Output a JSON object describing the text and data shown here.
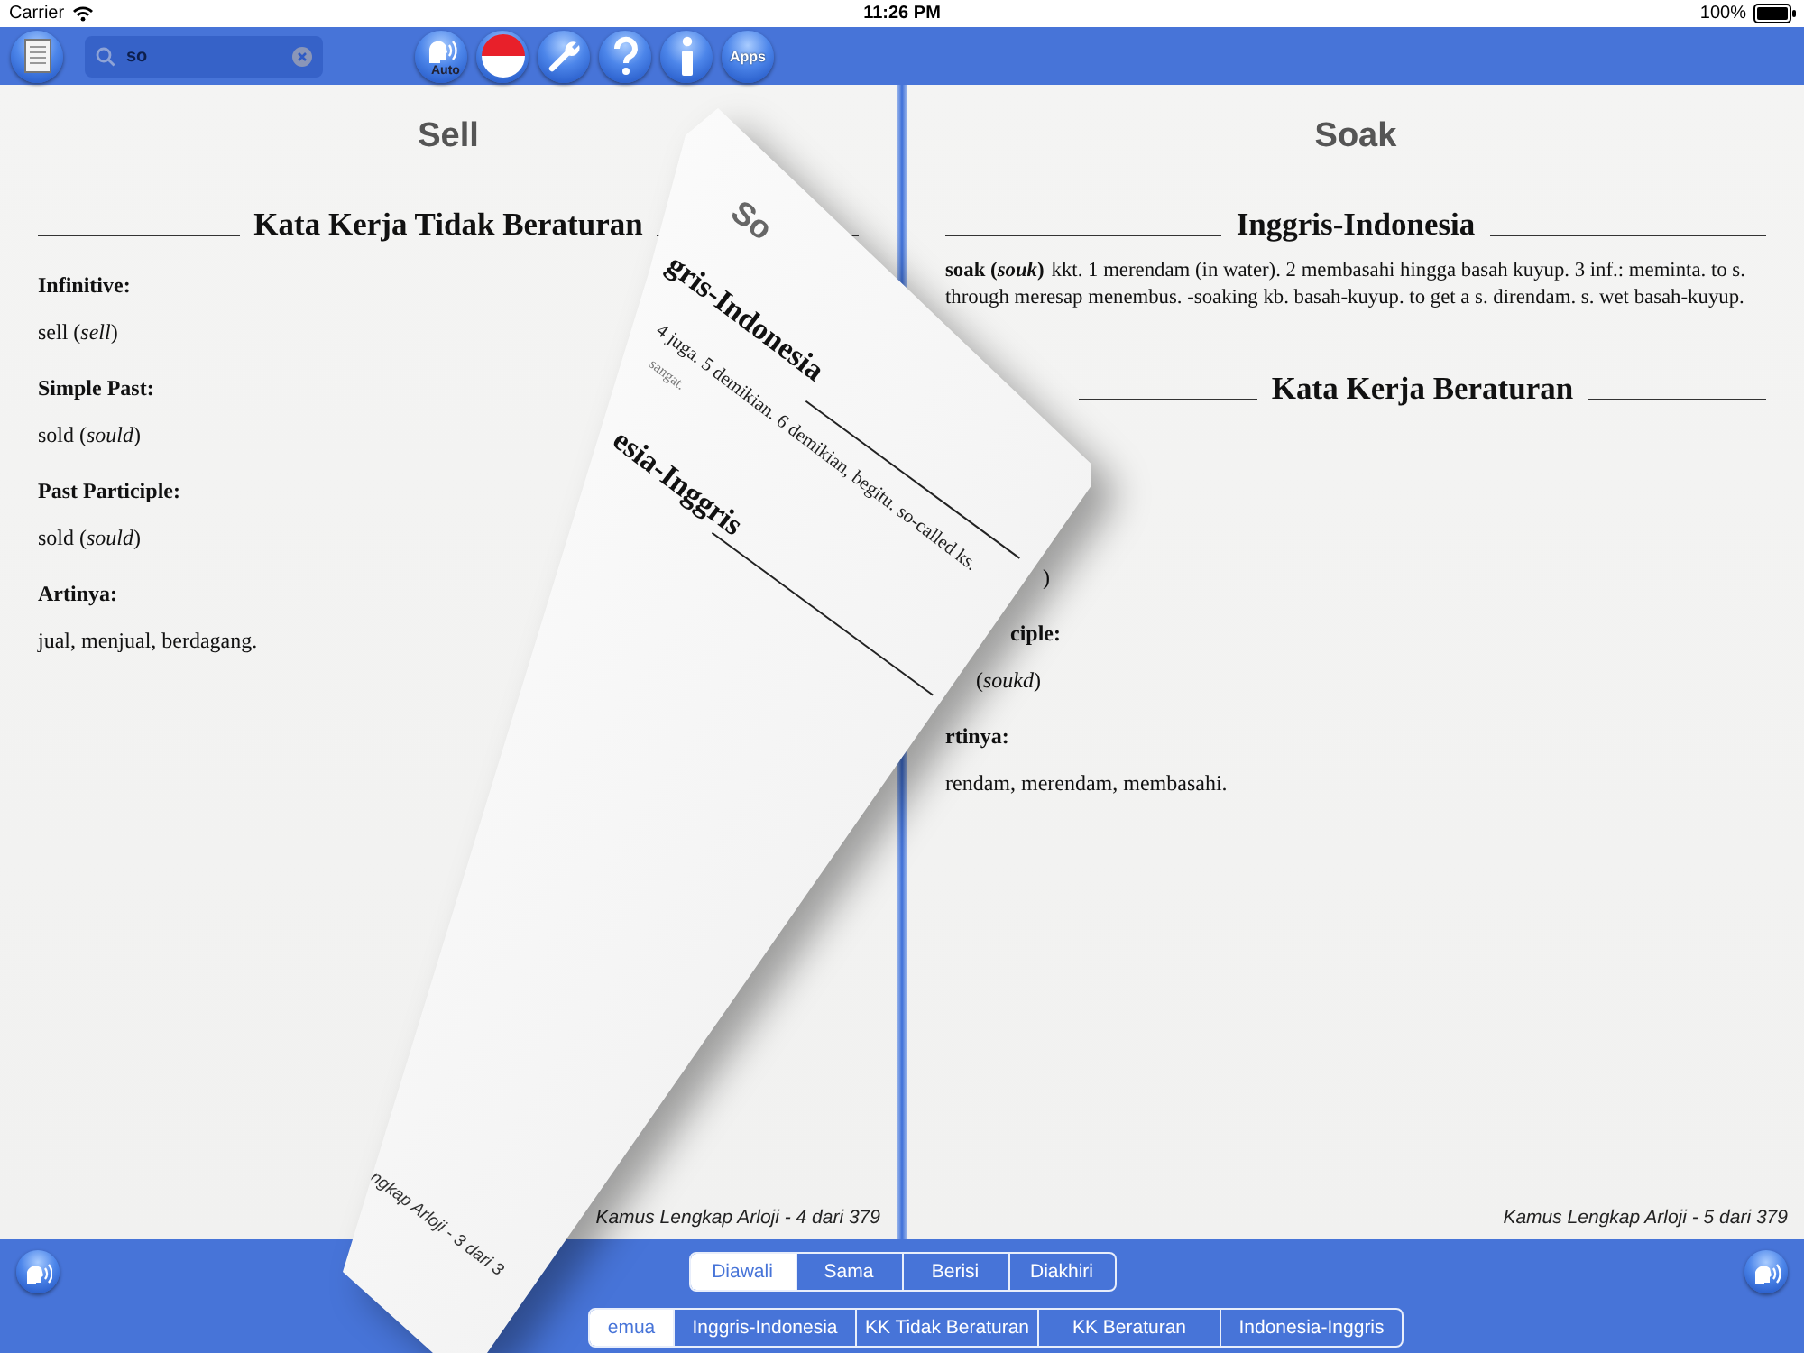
{
  "status_bar": {
    "carrier": "Carrier",
    "time": "11:26 PM",
    "battery": "100%"
  },
  "toolbar": {
    "search": {
      "value": "so"
    },
    "buttons": [
      {
        "kind": "speaker",
        "label": "Auto"
      },
      {
        "kind": "flag"
      },
      {
        "kind": "wrench"
      },
      {
        "kind": "help"
      },
      {
        "kind": "info"
      },
      {
        "kind": "apps",
        "label": "Apps"
      }
    ]
  },
  "left_page": {
    "title": "Sell",
    "section": "Kata Kerja Tidak Beraturan",
    "fields": [
      {
        "label": "Infinitive:",
        "value": "sell (*sell*)"
      },
      {
        "label": "Simple Past:",
        "value": "sold (*sould*)"
      },
      {
        "label": "Past Participle:",
        "value": "sold (*sould*)"
      },
      {
        "label": "Artinya:",
        "value": "jual, menjual, berdagang."
      }
    ],
    "footer": "Kamus Lengkap Arloji - 4 dari 379"
  },
  "right_page": {
    "title": "Soak",
    "section": "Inggris-Indonesia",
    "entry": {
      "headword": "soak (",
      "pronunciation": "souk",
      "headword_end": ")",
      "definition": "kkt. 1 merendam (in water). 2 membasahi hingga basah kuyup. 3 inf.: meminta. to s. through meresap menembus. -soaking kb. basah-kuyup. to get a s. direndam. s. wet basah-kuyup."
    },
    "section_2": "Kata Kerja Beraturan",
    "fragments": [
      {
        "text": ")",
        "kind": "value"
      },
      {
        "text": "ciple:",
        "kind": "label"
      },
      {
        "text": "(*soukd*)",
        "kind": "value"
      },
      {
        "text": "rtinya:",
        "kind": "label"
      },
      {
        "text": "rendam, merendam, membasahi.",
        "kind": "value"
      }
    ],
    "footer": "Kamus Lengkap Arloji - 5 dari 379"
  },
  "curl": {
    "title": "So",
    "heading_1": "gris-Indonesia",
    "definition": "4 juga. 5 demikian. 6 demikian, begitu. so-called ks.",
    "note": "sangat.",
    "heading_2": "esia-Inggris",
    "footer": "ngkap Arloji - 3 dari 3"
  },
  "match_modes": [
    {
      "label": "Diawali",
      "selected": true
    },
    {
      "label": "Sama",
      "selected": false
    },
    {
      "label": "Berisi",
      "selected": false
    },
    {
      "label": "Diakhiri",
      "selected": false
    }
  ],
  "categories": [
    {
      "label": "emua",
      "selected": true
    },
    {
      "label": "Inggris-Indonesia",
      "selected": false
    },
    {
      "label": "KK Tidak Beraturan",
      "selected": false
    },
    {
      "label": "KK Beraturan",
      "selected": false
    },
    {
      "label": "Indonesia-Inggris",
      "selected": false
    }
  ]
}
